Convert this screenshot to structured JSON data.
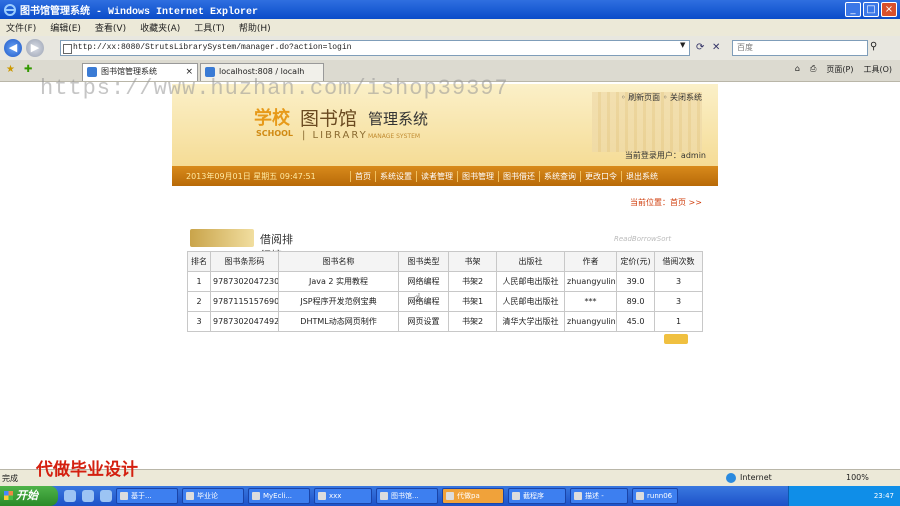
{
  "window": {
    "title": "图书馆管理系统 - Windows Internet Explorer",
    "min": "_",
    "max": "□",
    "close": "×"
  },
  "menu": [
    "文件(F)",
    "编辑(E)",
    "查看(V)",
    "收藏夹(A)",
    "工具(T)",
    "帮助(H)"
  ],
  "address": {
    "url": "http://xx:8080/StrutsLibrarySystem/manager.do?action=login",
    "search_placeholder": "百度"
  },
  "tabs": [
    {
      "label": "图书馆管理系统",
      "active": true
    },
    {
      "label": "localhost:808 / localh",
      "active": false
    }
  ],
  "ie_tools": {
    "page": "页面(P)",
    "tools": "工具(O)"
  },
  "watermark": "https://www.huzhan.com/ishop39397",
  "banner": {
    "school": "学校",
    "school_en": "SCHOOL",
    "library_cn": "图书馆",
    "library_en": "| LIBRARY",
    "system": "管理系统",
    "system_en": "MANAGE SYSTEM",
    "links": "◦ 刷新页面   ◦ 关闭系统",
    "login": "当前登录用户：admin"
  },
  "nav": {
    "date": "2013年09月01日 星期五 09:47:51",
    "items": [
      "首页",
      "系统设置",
      "读者管理",
      "图书管理",
      "图书借还",
      "系统查询",
      "更改口令",
      "退出系统"
    ]
  },
  "breadcrumb": "当前位置：首页 >>",
  "rank": {
    "title": "借阅排行榜",
    "title_en": "ReadBorrowSort"
  },
  "table": {
    "headers": [
      "排名",
      "图书条形码",
      "图书名称",
      "图书类型",
      "书架",
      "出版社",
      "作者",
      "定价(元)",
      "借阅次数"
    ],
    "rows": [
      [
        "1",
        "9787302047230",
        "Java 2 实用教程",
        "网络编程",
        "书架2",
        "人民邮电出版社",
        "zhuangyulin",
        "39.0",
        "3"
      ],
      [
        "2",
        "9787115157690",
        "JSP程序开发范例宝典",
        "网络编程",
        "书架1",
        "人民邮电出版社",
        "***",
        "89.0",
        "3"
      ],
      [
        "3",
        "9787302047492",
        "DHTML动态网页制作",
        "网页设置",
        "书架2",
        "清华大学出版社",
        "zhuangyulin",
        "45.0",
        "1"
      ]
    ]
  },
  "promo": "代做毕业设计",
  "status": {
    "left": "完成",
    "zone": "Internet",
    "zoom": "100%"
  },
  "taskbar": {
    "start": "开始",
    "tasks": [
      {
        "label": "基于...",
        "active": false
      },
      {
        "label": "毕业论",
        "active": false
      },
      {
        "label": "MyEcli...",
        "active": false
      },
      {
        "label": "xxx",
        "active": false
      },
      {
        "label": "图书馆...",
        "active": false
      },
      {
        "label": "代做pa",
        "active": true
      },
      {
        "label": "截程序",
        "active": false
      },
      {
        "label": "描述 -",
        "active": false
      },
      {
        "label": "runn06",
        "active": false
      }
    ],
    "clock": "23:47"
  }
}
